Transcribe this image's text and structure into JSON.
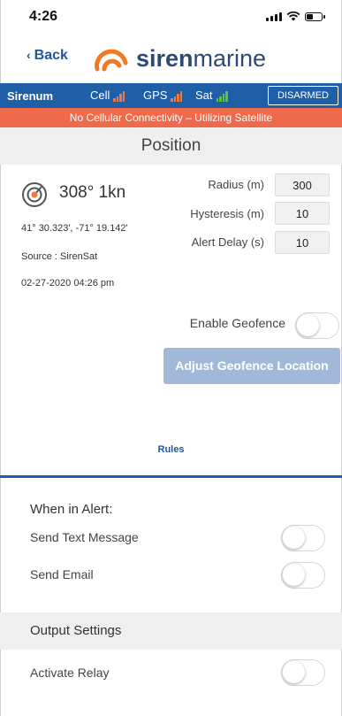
{
  "status_bar": {
    "time": "4:26"
  },
  "header": {
    "back_label": "Back",
    "logo_bold": "siren",
    "logo_light": "marine"
  },
  "top_bar": {
    "brand": "Sirenum",
    "indicators": [
      {
        "label": "Cell",
        "color": "#f07a42"
      },
      {
        "label": "GPS",
        "color": "#f07a42"
      },
      {
        "label": "Sat",
        "color": "#5cc63a"
      }
    ],
    "status_button": "DISARMED"
  },
  "alert_banner": "No Cellular Connectivity – Utilizing Satellite",
  "position": {
    "title": "Position",
    "heading": "308° 1kn",
    "coordinates": "41° 30.323', -71° 19.142'",
    "source": "Source : SirenSat",
    "timestamp": "02-27-2020 04:26 pm",
    "params": [
      {
        "label": "Radius (m)",
        "value": "300"
      },
      {
        "label": "Hysteresis (m)",
        "value": "10"
      },
      {
        "label": "Alert Delay (s)",
        "value": "10"
      }
    ],
    "enable_geofence_label": "Enable Geofence",
    "enable_geofence_on": false,
    "adjust_button": "Adjust Geofence Location",
    "rules_link": "Rules"
  },
  "when_in_alert": {
    "title": "When in Alert:",
    "items": [
      {
        "label": "Send Text Message",
        "on": false
      },
      {
        "label": "Send Email",
        "on": false
      }
    ]
  },
  "output_settings": {
    "title": "Output Settings",
    "items": [
      {
        "label": "Activate Relay",
        "on": false
      }
    ]
  },
  "colors": {
    "primary_blue": "#1f5fa8",
    "alert_orange": "#ee6a4a",
    "logo_orange": "#f07a22",
    "disabled_button": "#a2b8d8"
  }
}
